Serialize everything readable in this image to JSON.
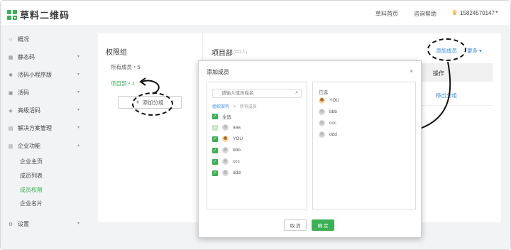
{
  "header": {
    "logo_text": "草料二维码",
    "nav": [
      "草料首页",
      "咨询帮助"
    ],
    "user_phone": "15824570147"
  },
  "sidebar": {
    "items": [
      {
        "label": "概况",
        "icon": "home-icon"
      },
      {
        "label": "静态码",
        "icon": "qrcode-icon"
      },
      {
        "label": "活码小程序版",
        "icon": "miniapp-icon"
      },
      {
        "label": "活码",
        "icon": "livecode-icon"
      },
      {
        "label": "高级活码",
        "icon": "advanced-icon"
      },
      {
        "label": "解决方案管理",
        "icon": "solution-icon"
      },
      {
        "label": "企业功能",
        "icon": "enterprise-icon"
      },
      {
        "label": "设置",
        "icon": "settings-icon"
      }
    ],
    "sub_items": [
      "企业主页",
      "成员列表",
      "成员权限",
      "企业名片"
    ],
    "active_sub": "成员权限"
  },
  "permission_groups": {
    "title": "权限组",
    "groups": [
      "所有成员・5",
      "项目部・1"
    ],
    "add_group_label": "添加分组"
  },
  "project": {
    "title": "项目部",
    "count": "(共1人)",
    "add_member_label": "添加成员",
    "more_label": "更多",
    "ops_header": "操作",
    "remove_label": "移出分组"
  },
  "dialog": {
    "title": "添加成员",
    "search_placeholder": "请输入成员姓名",
    "breadcrumb_link": "组织架构",
    "breadcrumb_sep": ">",
    "breadcrumb_current": "所有成员",
    "select_all": "全选",
    "members": [
      "aaa",
      "YOU",
      "bbb",
      "ccc",
      "ddd"
    ],
    "selected_label": "已选",
    "selected": [
      "YOU",
      "bbb",
      "ccc",
      "ddd"
    ],
    "cancel_label": "取 消",
    "ok_label": "确 定"
  },
  "colors": {
    "accent": "#3cb054",
    "link": "#3a8ee6"
  }
}
